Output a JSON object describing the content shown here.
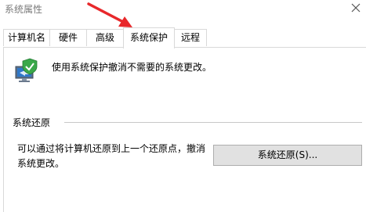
{
  "window": {
    "title": "系统属性",
    "close_icon": "close-icon"
  },
  "tabs": [
    {
      "label": "计算机名",
      "active": false
    },
    {
      "label": "硬件",
      "active": false
    },
    {
      "label": "高级",
      "active": false
    },
    {
      "label": "系统保护",
      "active": true
    },
    {
      "label": "远程",
      "active": false
    }
  ],
  "panel": {
    "icon": "shield-computer-icon",
    "description": "使用系统保护撤消不需要的系统更改。",
    "restore_section": {
      "label": "系统还原",
      "text": "可以通过将计算机还原到上一个还原点，撤消系统更改。",
      "button_label": "系统还原(S)..."
    }
  },
  "annotation": {
    "icon": "red-arrow-icon",
    "color": "#e8282b"
  }
}
